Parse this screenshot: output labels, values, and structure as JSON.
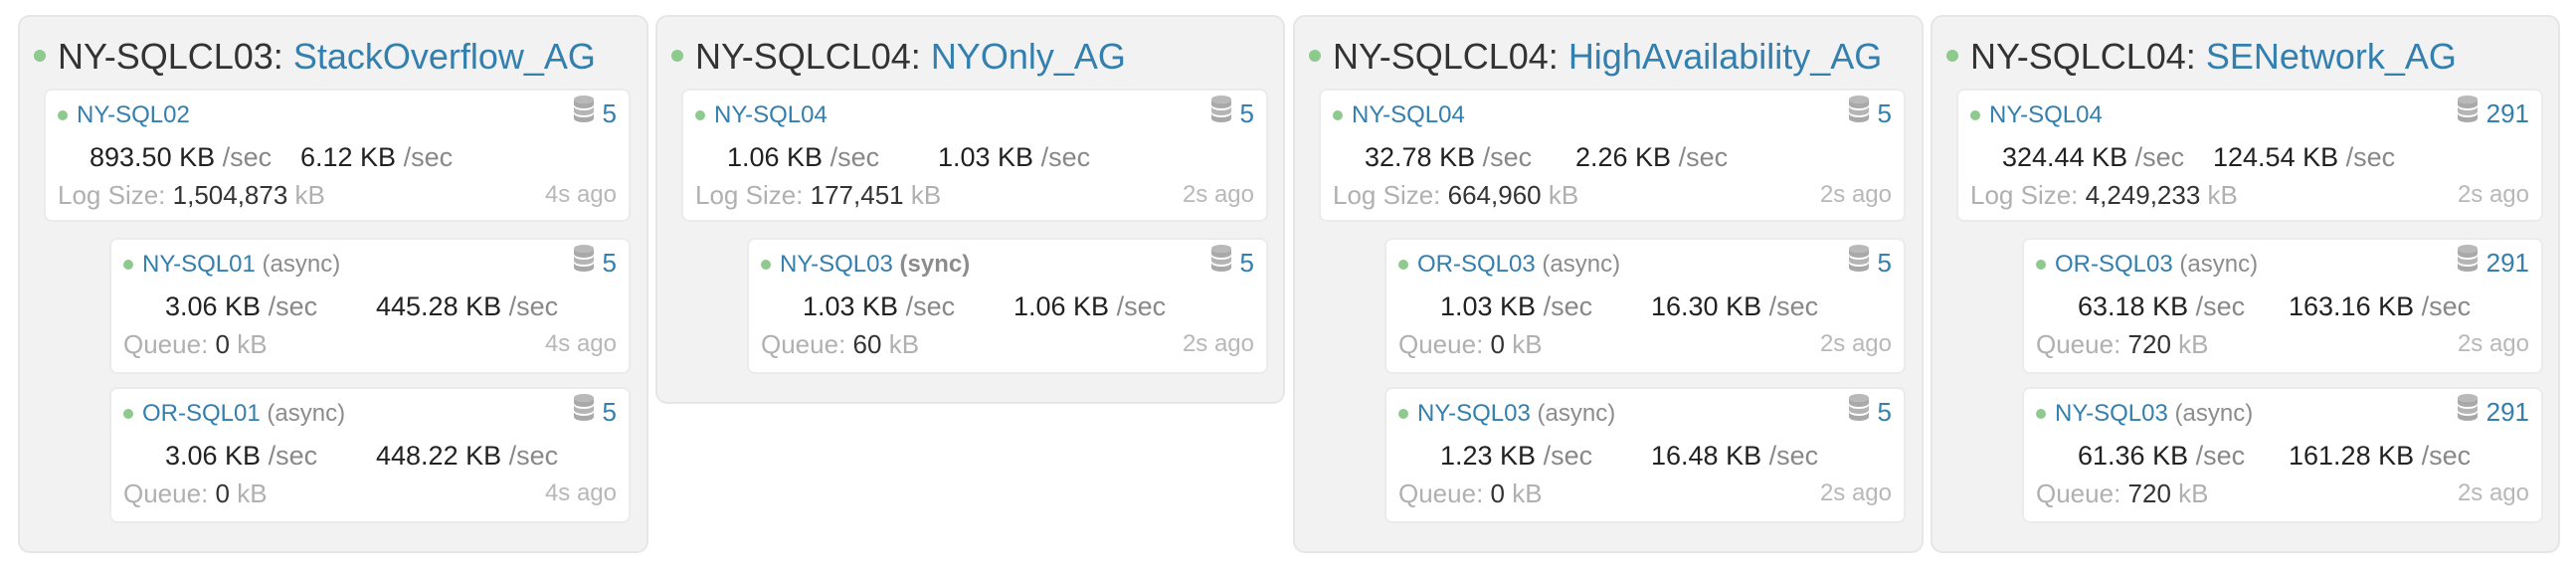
{
  "colors": {
    "link": "#337fae",
    "status_dot": "#8ec98e",
    "panel_bg": "#f2f2f2"
  },
  "groups": [
    {
      "cluster": "NY-SQLCL03:",
      "ag_name": "StackOverflow_AG",
      "nodes": [
        {
          "server": "NY-SQL02",
          "mode": "",
          "db_count": "5",
          "sent": "893.50 KB",
          "received": "6.12 KB",
          "rate_unit": "/sec",
          "meta_label": "Log Size:",
          "meta_value": "1,504,873",
          "meta_unit": "kB",
          "ago": "4s ago"
        },
        {
          "server": "NY-SQL01",
          "mode": "(async)",
          "db_count": "5",
          "sent": "3.06 KB",
          "received": "445.28 KB",
          "rate_unit": "/sec",
          "meta_label": "Queue:",
          "meta_value": "0",
          "meta_unit": "kB",
          "ago": "4s ago"
        },
        {
          "server": "OR-SQL01",
          "mode": "(async)",
          "db_count": "5",
          "sent": "3.06 KB",
          "received": "448.22 KB",
          "rate_unit": "/sec",
          "meta_label": "Queue:",
          "meta_value": "0",
          "meta_unit": "kB",
          "ago": "4s ago"
        }
      ]
    },
    {
      "cluster": "NY-SQLCL04:",
      "ag_name": "NYOnly_AG",
      "nodes": [
        {
          "server": "NY-SQL04",
          "mode": "",
          "db_count": "5",
          "sent": "1.06 KB",
          "received": "1.03 KB",
          "rate_unit": "/sec",
          "meta_label": "Log Size:",
          "meta_value": "177,451",
          "meta_unit": "kB",
          "ago": "2s ago"
        },
        {
          "server": "NY-SQL03",
          "mode": "(sync)",
          "db_count": "5",
          "sent": "1.03 KB",
          "received": "1.06 KB",
          "rate_unit": "/sec",
          "meta_label": "Queue:",
          "meta_value": "60",
          "meta_unit": "kB",
          "ago": "2s ago"
        }
      ]
    },
    {
      "cluster": "NY-SQLCL04:",
      "ag_name": "HighAvailability_AG",
      "nodes": [
        {
          "server": "NY-SQL04",
          "mode": "",
          "db_count": "5",
          "sent": "32.78 KB",
          "received": "2.26 KB",
          "rate_unit": "/sec",
          "meta_label": "Log Size:",
          "meta_value": "664,960",
          "meta_unit": "kB",
          "ago": "2s ago"
        },
        {
          "server": "OR-SQL03",
          "mode": "(async)",
          "db_count": "5",
          "sent": "1.03 KB",
          "received": "16.30 KB",
          "rate_unit": "/sec",
          "meta_label": "Queue:",
          "meta_value": "0",
          "meta_unit": "kB",
          "ago": "2s ago"
        },
        {
          "server": "NY-SQL03",
          "mode": "(async)",
          "db_count": "5",
          "sent": "1.23 KB",
          "received": "16.48 KB",
          "rate_unit": "/sec",
          "meta_label": "Queue:",
          "meta_value": "0",
          "meta_unit": "kB",
          "ago": "2s ago"
        }
      ]
    },
    {
      "cluster": "NY-SQLCL04:",
      "ag_name": "SENetwork_AG",
      "nodes": [
        {
          "server": "NY-SQL04",
          "mode": "",
          "db_count": "291",
          "sent": "324.44 KB",
          "received": "124.54 KB",
          "rate_unit": "/sec",
          "meta_label": "Log Size:",
          "meta_value": "4,249,233",
          "meta_unit": "kB",
          "ago": "2s ago"
        },
        {
          "server": "OR-SQL03",
          "mode": "(async)",
          "db_count": "291",
          "sent": "63.18 KB",
          "received": "163.16 KB",
          "rate_unit": "/sec",
          "meta_label": "Queue:",
          "meta_value": "720",
          "meta_unit": "kB",
          "ago": "2s ago"
        },
        {
          "server": "NY-SQL03",
          "mode": "(async)",
          "db_count": "291",
          "sent": "61.36 KB",
          "received": "161.28 KB",
          "rate_unit": "/sec",
          "meta_label": "Queue:",
          "meta_value": "720",
          "meta_unit": "kB",
          "ago": "2s ago"
        }
      ]
    }
  ]
}
